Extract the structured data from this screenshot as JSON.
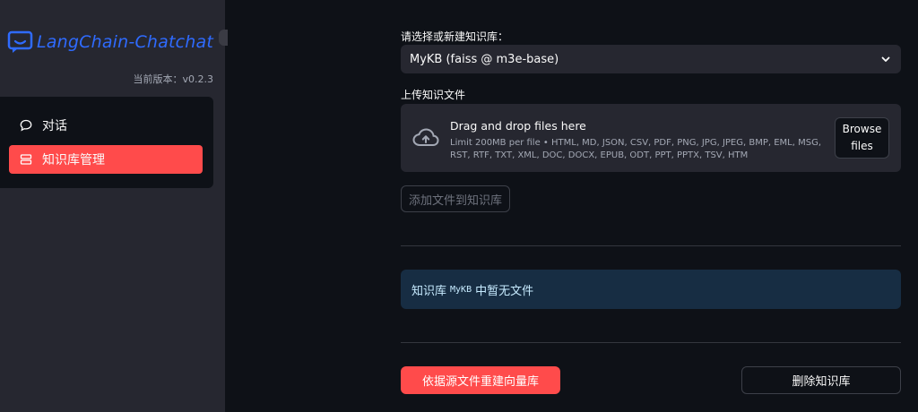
{
  "sidebar": {
    "logo_text": "LangChain-Chatchat",
    "version": "当前版本：v0.2.3",
    "items": [
      {
        "label": "对话",
        "icon": "chat-bubble-icon",
        "active": false
      },
      {
        "label": "知识库管理",
        "icon": "database-icon",
        "active": true
      }
    ]
  },
  "main": {
    "select_label": "请选择或新建知识库：",
    "selected_kb": "MyKB (faiss @ m3e-base)",
    "upload_label": "上传知识文件",
    "uploader": {
      "title": "Drag and drop files here",
      "limit": "Limit 200MB per file • HTML, MD, JSON, CSV, PDF, PNG, JPG, JPEG, BMP, EML, MSG, RST, RTF, TXT, XML, DOC, DOCX, EPUB, ODT, PPT, PPTX, TSV, HTM",
      "browse_label": "Browse\nfiles"
    },
    "add_button": "添加文件到知识库",
    "info": {
      "prefix": "知识库",
      "kb_name": "MyKB",
      "suffix": "中暂无文件"
    },
    "rebuild_button": "依据源文件重建向量库",
    "delete_button": "删除知识库"
  },
  "colors": {
    "accent": "#ff4b4b",
    "logo": "#2f6bff",
    "sidebar_bg": "#262730",
    "main_bg": "#0e1117",
    "info_bg": "#172d43"
  }
}
